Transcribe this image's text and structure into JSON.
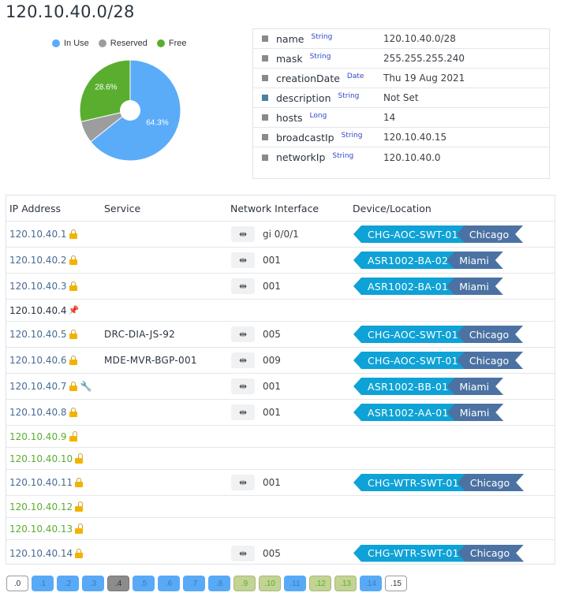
{
  "page": {
    "title": "120.10.40.0/28"
  },
  "chart_data": {
    "type": "pie",
    "title": "",
    "legend_position": "top",
    "categories": [
      "In Use",
      "Reserved",
      "Free"
    ],
    "values": [
      64.3,
      7.1,
      28.6
    ],
    "labels": [
      "64.3%",
      "",
      "28.6%"
    ],
    "colors": [
      "#5aacf8",
      "#9d9d9d",
      "#5aae2f"
    ],
    "donut_hole": true
  },
  "properties": [
    {
      "key": "name",
      "type": "String",
      "value": "120.10.40.0/28",
      "marker": "gray"
    },
    {
      "key": "mask",
      "type": "String",
      "value": "255.255.255.240",
      "marker": "gray"
    },
    {
      "key": "creationDate",
      "type": "Date",
      "value": "Thu 19 Aug 2021",
      "marker": "gray"
    },
    {
      "key": "description",
      "type": "String",
      "value": "Not Set",
      "marker": "blue"
    },
    {
      "key": "hosts",
      "type": "Long",
      "value": "14",
      "marker": "gray"
    },
    {
      "key": "broadcastIp",
      "type": "String",
      "value": "120.10.40.15",
      "marker": "gray"
    },
    {
      "key": "networkIp",
      "type": "String",
      "value": "120.10.40.0",
      "marker": "gray"
    }
  ],
  "table": {
    "headers": [
      "IP Address",
      "Service",
      "Network Interface",
      "Device/Location"
    ],
    "rows": [
      {
        "ip": "120.10.40.1",
        "status": "inuse",
        "icons": [
          "lock"
        ],
        "service": "",
        "interface": "gi 0/0/1",
        "device": "CHG-AOC-SWT-01",
        "location": "Chicago"
      },
      {
        "ip": "120.10.40.2",
        "status": "inuse",
        "icons": [
          "lock"
        ],
        "service": "",
        "interface": "001",
        "device": "ASR1002-BA-02",
        "location": "Miami"
      },
      {
        "ip": "120.10.40.3",
        "status": "inuse",
        "icons": [
          "lock"
        ],
        "service": "",
        "interface": "001",
        "device": "ASR1002-BA-01",
        "location": "Miami"
      },
      {
        "ip": "120.10.40.4",
        "status": "reserved",
        "icons": [
          "pin"
        ],
        "service": "",
        "interface": "",
        "device": "",
        "location": ""
      },
      {
        "ip": "120.10.40.5",
        "status": "inuse",
        "icons": [
          "lock"
        ],
        "service": "DRC-DIA-JS-92",
        "interface": "005",
        "device": "CHG-AOC-SWT-01",
        "location": "Chicago"
      },
      {
        "ip": "120.10.40.6",
        "status": "inuse",
        "icons": [
          "lock"
        ],
        "service": "MDE-MVR-BGP-001",
        "interface": "009",
        "device": "CHG-AOC-SWT-01",
        "location": "Chicago"
      },
      {
        "ip": "120.10.40.7",
        "status": "inuse",
        "icons": [
          "lock",
          "wrench"
        ],
        "service": "",
        "interface": "001",
        "device": "ASR1002-BB-01",
        "location": "Miami"
      },
      {
        "ip": "120.10.40.8",
        "status": "inuse",
        "icons": [
          "lock"
        ],
        "service": "",
        "interface": "001",
        "device": "ASR1002-AA-01",
        "location": "Miami"
      },
      {
        "ip": "120.10.40.9",
        "status": "free",
        "icons": [
          "unlock"
        ],
        "service": "",
        "interface": "",
        "device": "",
        "location": ""
      },
      {
        "ip": "120.10.40.10",
        "status": "free",
        "icons": [
          "unlock"
        ],
        "service": "",
        "interface": "",
        "device": "",
        "location": ""
      },
      {
        "ip": "120.10.40.11",
        "status": "inuse",
        "icons": [
          "lock"
        ],
        "service": "",
        "interface": "001",
        "device": "CHG-WTR-SWT-01",
        "location": "Chicago"
      },
      {
        "ip": "120.10.40.12",
        "status": "free",
        "icons": [
          "unlock"
        ],
        "service": "",
        "interface": "",
        "device": "",
        "location": ""
      },
      {
        "ip": "120.10.40.13",
        "status": "free",
        "icons": [
          "unlock"
        ],
        "service": "",
        "interface": "",
        "device": "",
        "location": ""
      },
      {
        "ip": "120.10.40.14",
        "status": "inuse",
        "icons": [
          "lock"
        ],
        "service": "",
        "interface": "005",
        "device": "CHG-WTR-SWT-01",
        "location": "Chicago"
      }
    ]
  },
  "chips": [
    {
      "label": ".0",
      "status": "empty"
    },
    {
      "label": ".1",
      "status": "inuse"
    },
    {
      "label": ".2",
      "status": "inuse"
    },
    {
      "label": ".3",
      "status": "inuse"
    },
    {
      "label": ".4",
      "status": "reserved"
    },
    {
      "label": ".5",
      "status": "inuse"
    },
    {
      "label": ".6",
      "status": "inuse"
    },
    {
      "label": ".7",
      "status": "inuse"
    },
    {
      "label": ".8",
      "status": "inuse"
    },
    {
      "label": ".9",
      "status": "free"
    },
    {
      "label": ".10",
      "status": "free"
    },
    {
      "label": ".11",
      "status": "inuse"
    },
    {
      "label": ".12",
      "status": "free"
    },
    {
      "label": ".13",
      "status": "free"
    },
    {
      "label": ".14",
      "status": "inuse"
    },
    {
      "label": ".15",
      "status": "empty"
    }
  ],
  "icons": {
    "interface": "link-break-icon",
    "lock": "lock-icon",
    "unlock": "unlock-icon",
    "pin": "pushpin-icon",
    "wrench": "wrench-icon"
  }
}
